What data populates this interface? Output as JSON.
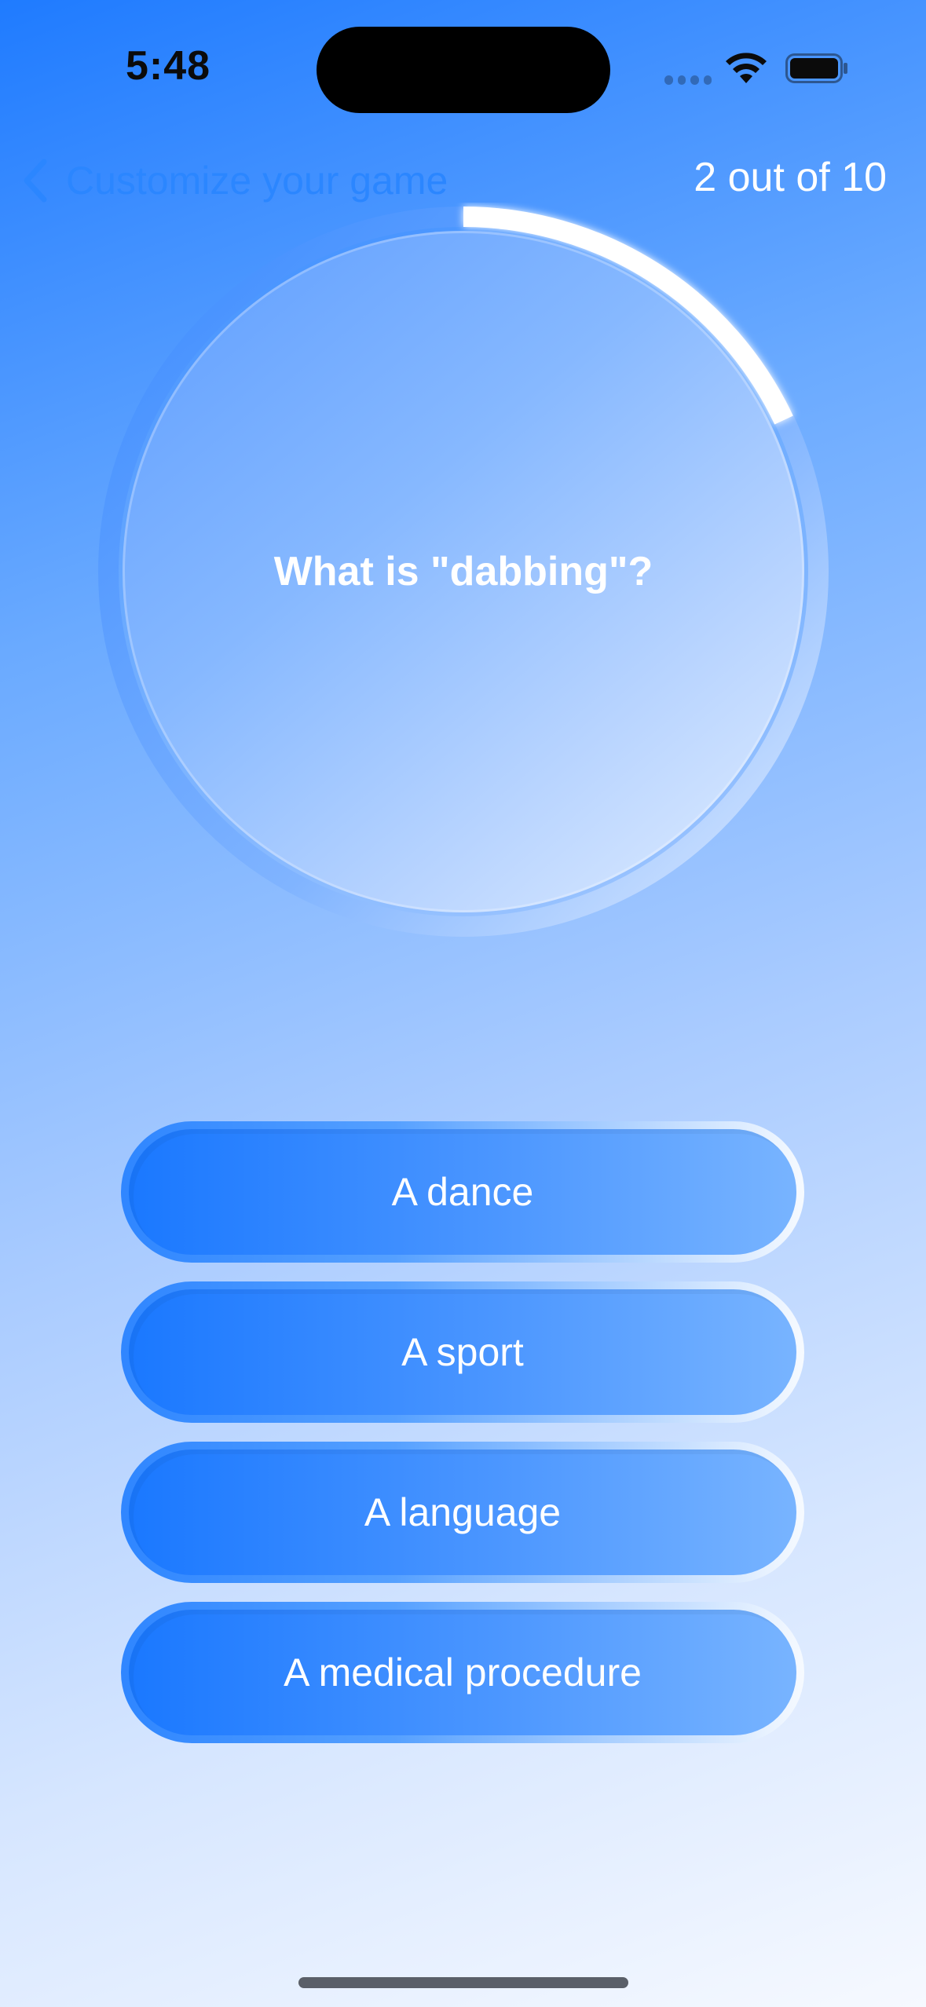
{
  "status_bar": {
    "time": "5:48",
    "icons": [
      "signal-icon",
      "wifi-icon",
      "battery-icon"
    ]
  },
  "nav": {
    "back_label": "Customize your game",
    "progress": "2 out of 10"
  },
  "question": {
    "text": "What is \"dabbing\"?",
    "timer_remaining_fraction": 0.8
  },
  "answers": [
    {
      "label": "A dance"
    },
    {
      "label": "A sport"
    },
    {
      "label": "A language"
    },
    {
      "label": "A medical procedure"
    }
  ],
  "colors": {
    "accent": "#2b86ff",
    "answer_start": "#1a78ff",
    "answer_end": "#78b4ff",
    "background_top": "#1f7bff",
    "background_bottom": "#f6f9ff"
  }
}
